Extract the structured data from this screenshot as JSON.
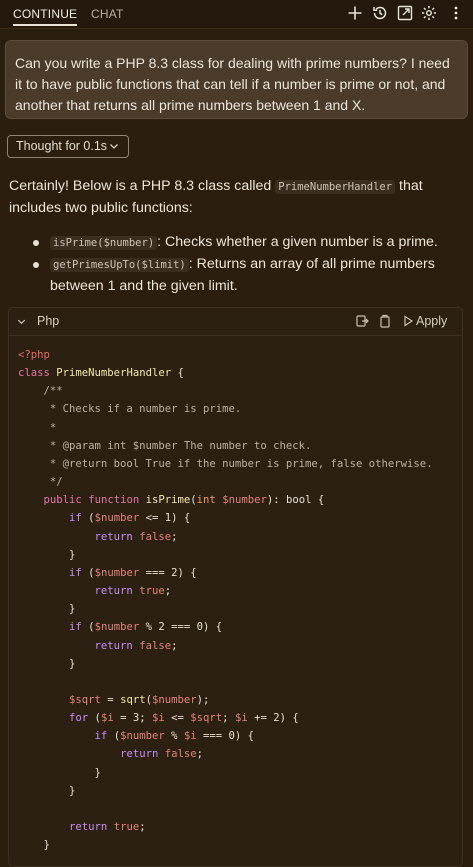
{
  "tabs": [
    {
      "label": "CONTINUE",
      "active": true
    },
    {
      "label": "CHAT",
      "active": false
    }
  ],
  "toolbar_icons": [
    "plus-icon",
    "history-icon",
    "open-external-icon",
    "gear-icon",
    "more-icon"
  ],
  "prompt": {
    "text": "Can you write a PHP 8.3 class for dealing with prime numbers? I need it to have public functions that can tell if a number is prime or not, and another that returns all prime numbers between 1 and X."
  },
  "thought": {
    "label": "Thought for 0.1s"
  },
  "response": {
    "intro_before": "Certainly! Below is a PHP 8.3 class called ",
    "class_name": "PrimeNumberHandler",
    "intro_after": " that includes two public functions:",
    "bullets": [
      {
        "code": "isPrime($number)",
        "text": ": Checks whether a given number is a prime."
      },
      {
        "code": "getPrimesUpTo($limit)",
        "text": ": Returns an array of all prime numbers between 1 and the given limit."
      }
    ]
  },
  "code_block": {
    "language": "Php",
    "apply_label": "Apply",
    "lines": [
      "<?php",
      "class PrimeNumberHandler {",
      "    /**",
      "     * Checks if a number is prime.",
      "     *",
      "     * @param int $number The number to check.",
      "     * @return bool True if the number is prime, false otherwise.",
      "     */",
      "    public function isPrime(int $number): bool {",
      "        if ($number <= 1) {",
      "            return false;",
      "        }",
      "        if ($number === 2) {",
      "            return true;",
      "        }",
      "        if ($number % 2 === 0) {",
      "            return false;",
      "        }",
      "",
      "        $sqrt = sqrt($number);",
      "        for ($i = 3; $i <= $sqrt; $i += 2) {",
      "            if ($number % $i === 0) {",
      "                return false;",
      "            }",
      "        }",
      "",
      "        return true;",
      "    }"
    ]
  }
}
